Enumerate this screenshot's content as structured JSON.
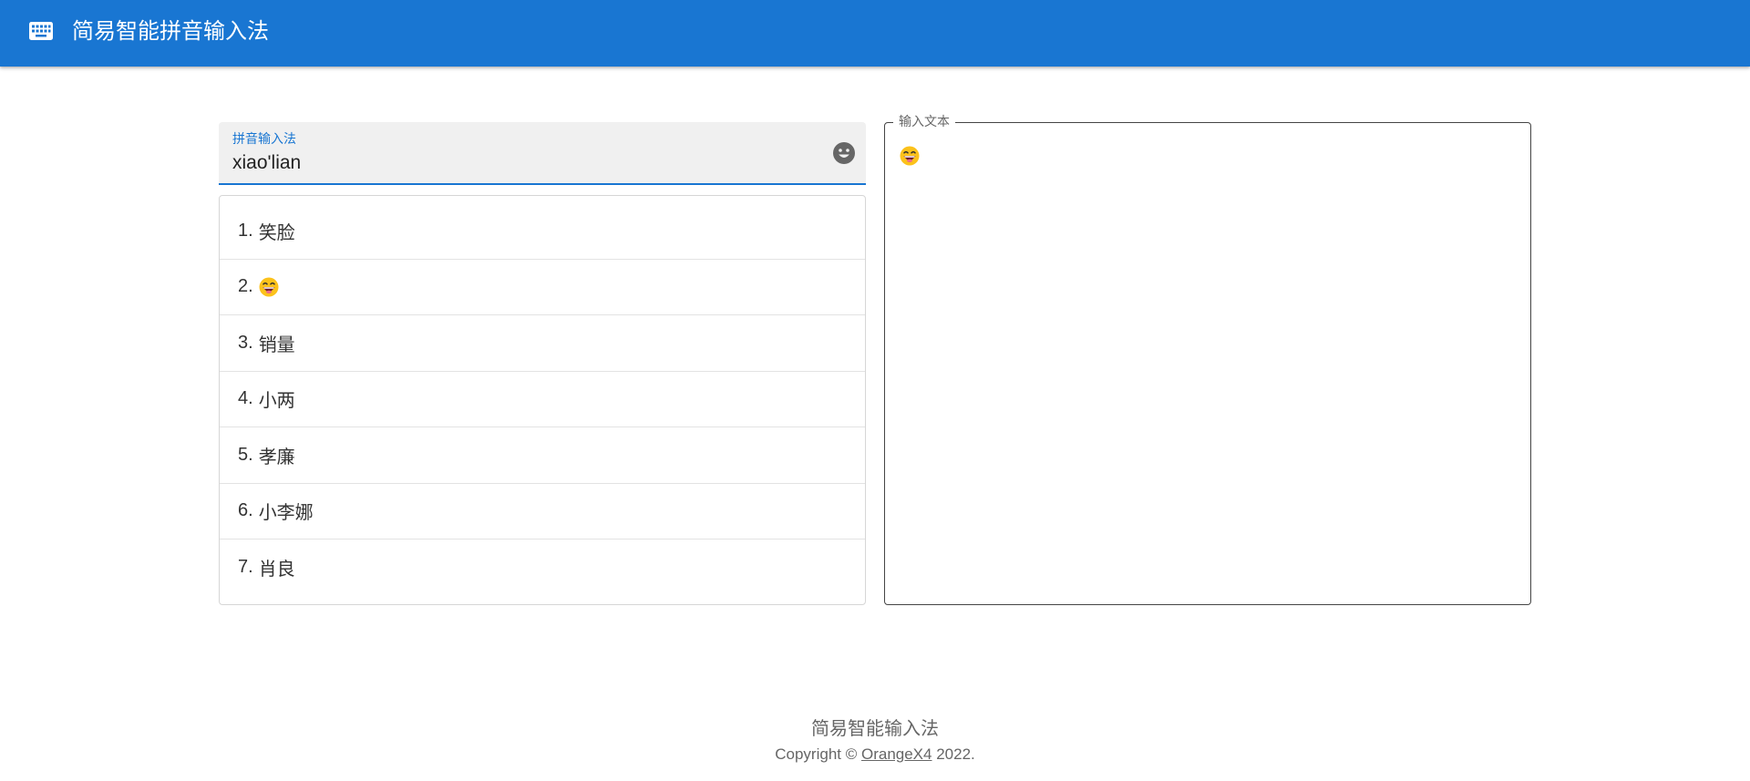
{
  "appbar": {
    "icon": "keyboard-icon",
    "title": "简易智能拼音输入法",
    "background_color": "#1976d2"
  },
  "pinyin_input": {
    "label": "拼音输入法",
    "value": "xiao'lian",
    "emoji_icon": "smiley-face-icon"
  },
  "candidates": [
    {
      "index": "1.",
      "text": "笑脸"
    },
    {
      "index": "2.",
      "text": "",
      "icon": "grinning-face-emoji"
    },
    {
      "index": "3.",
      "text": "销量"
    },
    {
      "index": "4.",
      "text": "小两"
    },
    {
      "index": "5.",
      "text": "孝廉"
    },
    {
      "index": "6.",
      "text": "小李娜"
    },
    {
      "index": "7.",
      "text": "肖良"
    }
  ],
  "output": {
    "legend": "输入文本",
    "content_icon": "grinning-face-emoji"
  },
  "footer": {
    "title": "简易智能输入法",
    "copyright_prefix": "Copyright ©",
    "author_link": "OrangeX4",
    "year": "2022."
  }
}
